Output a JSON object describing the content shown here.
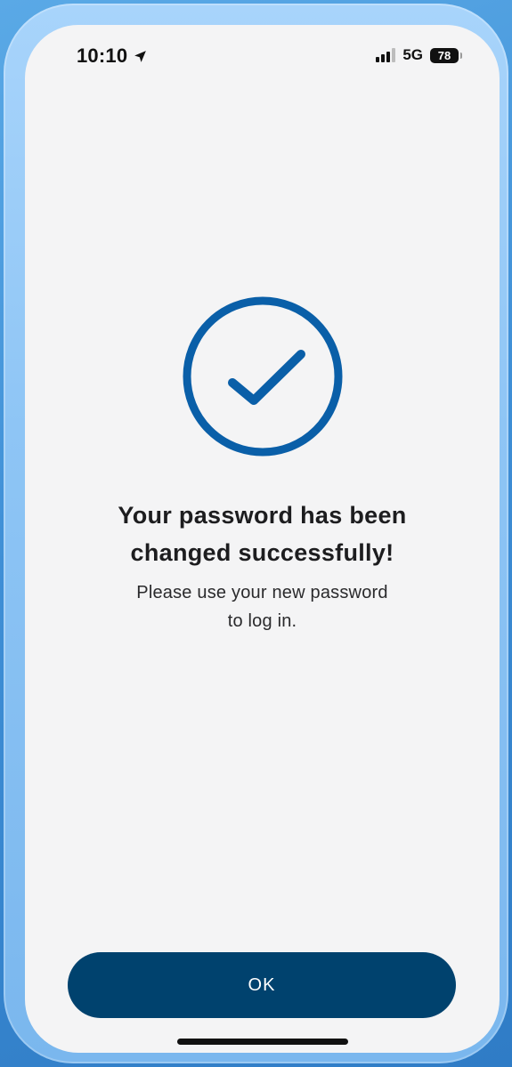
{
  "status_bar": {
    "time": "10:10",
    "network": "5G",
    "battery": "78"
  },
  "main": {
    "title_line1": "Your password has been",
    "title_line2": "changed successfully!",
    "subtitle_line1": "Please use your new password",
    "subtitle_line2": "to log in."
  },
  "actions": {
    "ok_label": "OK"
  },
  "colors": {
    "accent": "#0a5fa8",
    "button": "#00426e",
    "screen_bg": "#f4f4f5"
  },
  "icons": {
    "location": "location-arrow-icon",
    "signal": "cellular-signal-icon",
    "battery": "battery-icon",
    "success": "checkmark-circle-icon"
  }
}
